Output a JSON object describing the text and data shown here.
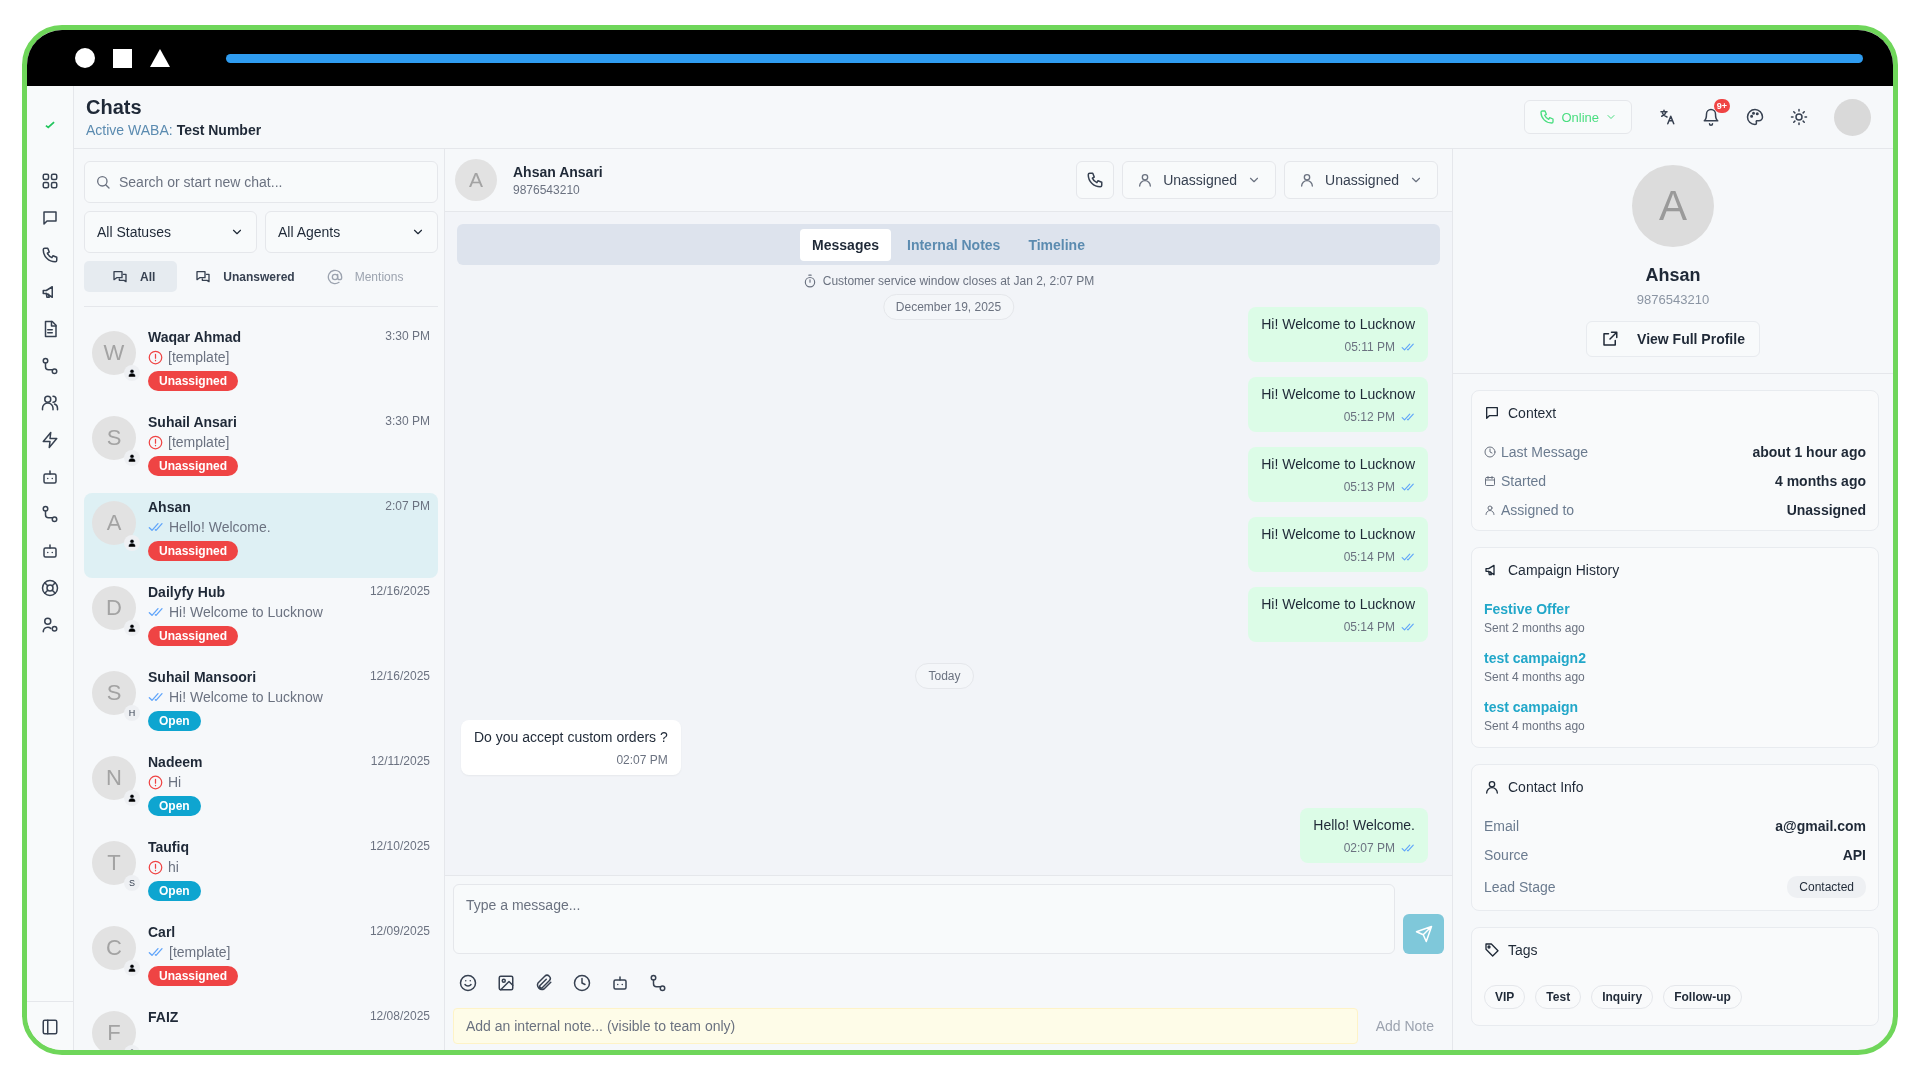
{
  "header": {
    "title": "Chats",
    "subtitle_label": "Active WABA:",
    "subtitle_value": "Test Number",
    "status": "Online",
    "notification_badge": "9+"
  },
  "chat_list": {
    "search": {
      "placeholder": "Search or start new chat..."
    },
    "filters": [
      "All Statuses",
      "All Agents"
    ],
    "tabs": [
      {
        "label": "All",
        "selected": true
      },
      {
        "label": "Unanswered",
        "selected": false
      },
      {
        "label": "Mentions",
        "selected": false
      }
    ],
    "chats": [
      {
        "initial": "W",
        "name": "Waqar Ahmad",
        "time": "3:30 PM",
        "failed": true,
        "preview": "[template]",
        "status": {
          "label": "Unassigned",
          "color": "#ef4444"
        },
        "selected": false
      },
      {
        "initial": "S",
        "name": "Suhail Ansari",
        "time": "3:30 PM",
        "failed": true,
        "preview": "[template]",
        "status": {
          "label": "Unassigned",
          "color": "#ef4444"
        },
        "selected": false
      },
      {
        "initial": "A",
        "name": "Ahsan",
        "time": "2:07 PM",
        "failed": false,
        "preview": "Hello! Welcome.",
        "status": {
          "label": "Unassigned",
          "color": "#ef4444"
        },
        "selected": true
      },
      {
        "initial": "D",
        "name": "Dailyfy Hub",
        "time": "12/16/2025",
        "failed": false,
        "preview": "Hi! Welcome to Lucknow",
        "status": {
          "label": "Unassigned",
          "color": "#ef4444"
        },
        "selected": false
      },
      {
        "initial": "S",
        "name": "Suhail Mansoori",
        "agent_initial": "H",
        "time": "12/16/2025",
        "failed": false,
        "preview": "Hi! Welcome to Lucknow",
        "status": {
          "label": "Open",
          "color": "#0ea5d0"
        },
        "selected": false
      },
      {
        "initial": "N",
        "name": "Nadeem",
        "time": "12/11/2025",
        "failed": true,
        "preview": "Hi",
        "status": {
          "label": "Open",
          "color": "#0ea5d0"
        },
        "selected": false
      },
      {
        "initial": "T",
        "name": "Taufiq",
        "agent_initial": "S",
        "time": "12/10/2025",
        "failed": true,
        "preview": "hi",
        "status": {
          "label": "Open",
          "color": "#0ea5d0"
        },
        "selected": false
      },
      {
        "initial": "C",
        "name": "Carl",
        "time": "12/09/2025",
        "failed": false,
        "preview": "[template]",
        "status": {
          "label": "Unassigned",
          "color": "#ef4444"
        },
        "selected": false
      },
      {
        "initial": "F",
        "name": "FAIZ",
        "time": "12/08/2025",
        "selected": false
      }
    ]
  },
  "conversation": {
    "initial": "A",
    "name": "Ahsan Ansari",
    "phone": "9876543210",
    "assign_dropdowns": [
      "Unassigned",
      "Unassigned"
    ],
    "tabs": [
      {
        "label": "Messages",
        "selected": true
      },
      {
        "label": "Internal Notes",
        "selected": false
      },
      {
        "label": "Timeline",
        "selected": false
      }
    ],
    "notice": "Customer service window closes at Jan 2, 2:07 PM",
    "sticky_date": "December 19, 2025",
    "messages": [
      {
        "kind": "outgoing",
        "text": "Hi! Welcome to Lucknow",
        "time": "05:11 PM",
        "read": true
      },
      {
        "kind": "outgoing",
        "text": "Hi! Welcome to Lucknow",
        "time": "05:12 PM",
        "read": true
      },
      {
        "kind": "outgoing",
        "text": "Hi! Welcome to Lucknow",
        "time": "05:13 PM",
        "read": true
      },
      {
        "kind": "outgoing",
        "text": "Hi! Welcome to Lucknow",
        "time": "05:14 PM",
        "read": true
      },
      {
        "kind": "outgoing",
        "text": "Hi! Welcome to Lucknow",
        "time": "05:14 PM",
        "read": true
      },
      {
        "kind": "date",
        "text": "Today"
      },
      {
        "kind": "incoming",
        "text": "Do you accept custom orders ?",
        "time": "02:07 PM"
      },
      {
        "kind": "outgoing",
        "text": "Hello! Welcome.",
        "time": "02:07 PM",
        "read": true
      }
    ],
    "composer": {
      "placeholder": "Type a message..."
    },
    "note": {
      "placeholder": "Add an internal note... (visible to team only)",
      "button": "Add Note",
      "disabled": true
    }
  },
  "profile": {
    "initial": "A",
    "name": "Ahsan",
    "phone": "9876543210",
    "button": "View Full Profile"
  },
  "context": {
    "title": "Context",
    "rows": [
      {
        "label": "Last Message",
        "value": "about 1 hour ago"
      },
      {
        "label": "Started",
        "value": "4 months ago"
      },
      {
        "label": "Assigned to",
        "value": "Unassigned"
      }
    ]
  },
  "campaign_history": {
    "title": "Campaign History",
    "items": [
      {
        "name": "Festive Offer",
        "sent": "Sent 2 months ago"
      },
      {
        "name": "test campaign2",
        "sent": "Sent 4 months ago"
      },
      {
        "name": "test campaign",
        "sent": "Sent 4 months ago"
      }
    ]
  },
  "contact_info": {
    "title": "Contact Info",
    "rows": [
      {
        "label": "Email",
        "value": "a@gmail.com",
        "kind": "text"
      },
      {
        "label": "Source",
        "value": "API",
        "kind": "text"
      },
      {
        "label": "Lead Stage",
        "value": "Contacted",
        "kind": "pill"
      }
    ]
  },
  "tags": {
    "title": "Tags",
    "items": [
      "VIP",
      "Test",
      "Inquiry",
      "Follow-up"
    ]
  }
}
